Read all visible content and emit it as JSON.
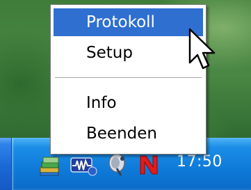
{
  "context_menu": {
    "items": [
      {
        "label": "Protokoll",
        "highlighted": true
      },
      {
        "label": "Setup",
        "highlighted": false
      },
      {
        "label": "Info",
        "highlighted": false
      },
      {
        "label": "Beenden",
        "highlighted": false
      }
    ]
  },
  "tray": {
    "icons": [
      "stacked-books-icon",
      "network-signal-icon",
      "satellite-dish-icon",
      "red-n-icon"
    ],
    "clock": "17:50"
  },
  "colors": {
    "menu_highlight": "#2f6fd0",
    "taskbar": "#1a68d6",
    "tray": "#0f7ad8"
  },
  "cursor": "arrow-cursor-icon"
}
